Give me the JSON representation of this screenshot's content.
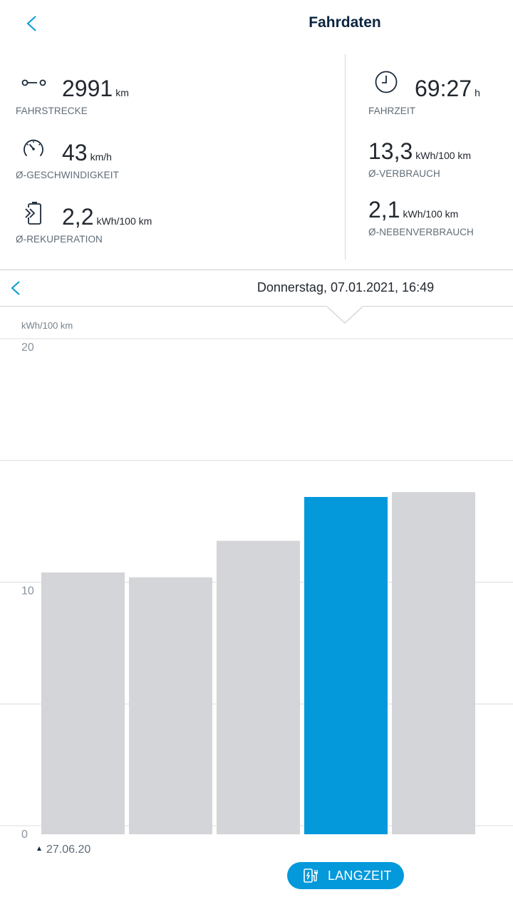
{
  "header": {
    "title": "Fahrdaten"
  },
  "stats": {
    "distance": {
      "value": "2991",
      "unit": "km",
      "label": "FAHRSTRECKE",
      "icon": "route-icon"
    },
    "speed": {
      "value": "43",
      "unit": "km/h",
      "label": "Ø-GESCHWINDIGKEIT",
      "icon": "speedometer-icon"
    },
    "recuperation": {
      "value": "2,2",
      "unit": "kWh/100 km",
      "label": "Ø-REKUPERATION",
      "icon": "battery-charge-icon"
    },
    "time": {
      "value": "69:27",
      "unit": "h",
      "label": "FAHRZEIT",
      "icon": "clock-icon"
    },
    "consumption": {
      "value": "13,3",
      "unit": "kWh/100 km",
      "label": "Ø-VERBRAUCH"
    },
    "aux_consumption": {
      "value": "2,1",
      "unit": "kWh/100 km",
      "label": "Ø-NEBENVERBRAUCH"
    }
  },
  "date_bar": {
    "date": "Donnerstag, 07.01.2021, 16:49"
  },
  "chart_data": {
    "type": "bar",
    "ylabel": "kWh/100 km",
    "ylim": [
      0,
      20
    ],
    "yticks": [
      0,
      10,
      20
    ],
    "categories": [
      "",
      "",
      "",
      "",
      ""
    ],
    "values": [
      10.4,
      10.2,
      11.7,
      13.5,
      13.7
    ],
    "selected_index": 3,
    "start_label": "27.06.20",
    "grid": true,
    "colors": {
      "bar": "#d4d5d8",
      "selected": "#0499db",
      "grid": "#dcdcdc"
    }
  },
  "footer": {
    "button_label": "LANGZEIT",
    "icon": "charging-station-icon"
  },
  "colors": {
    "accent": "#0499db",
    "title": "#0a2540",
    "text": "#22282f",
    "muted": "#5f6b77"
  }
}
